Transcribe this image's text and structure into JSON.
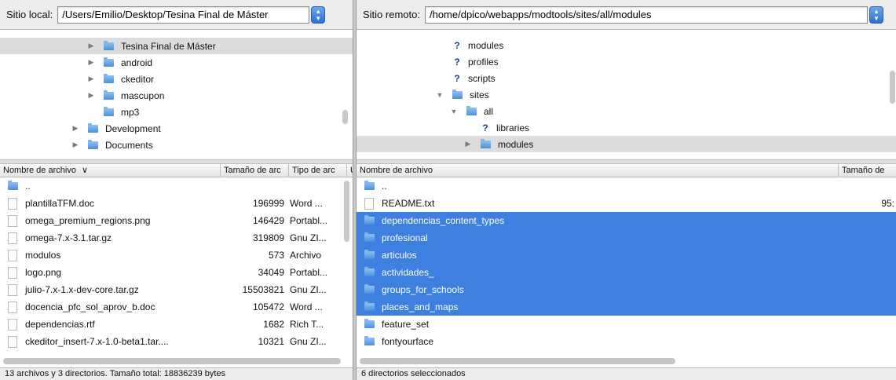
{
  "local": {
    "label": "Sitio local:",
    "path": "/Users/Emilio/Desktop/Tesina Final de Máster",
    "tree": [
      {
        "name": "Tesina Final de Máster",
        "indent": 2,
        "kind": "folder",
        "expander": true,
        "selected": true
      },
      {
        "name": "android",
        "indent": 2,
        "kind": "folder",
        "expander": true
      },
      {
        "name": "ckeditor",
        "indent": 2,
        "kind": "folder",
        "expander": true
      },
      {
        "name": "mascupon",
        "indent": 2,
        "kind": "folder",
        "expander": true
      },
      {
        "name": "mp3",
        "indent": 2,
        "kind": "folder",
        "expander": false
      },
      {
        "name": "Development",
        "indent": 1,
        "kind": "folder",
        "expander": true
      },
      {
        "name": "Documents",
        "indent": 1,
        "kind": "folder",
        "expander": true
      }
    ],
    "columns": {
      "name": "Nombre de archivo",
      "size": "Tamaño de arc",
      "type": "Tipo de arc",
      "last": "Ú"
    },
    "sort_indicator": "∨",
    "files": [
      {
        "name": "..",
        "size": "",
        "type": "",
        "icon": "folder"
      },
      {
        "name": "plantillaTFM.doc",
        "size": "196999",
        "type": "Word ...",
        "icon": "doc"
      },
      {
        "name": "omega_premium_regions.png",
        "size": "146429",
        "type": "Portabl...",
        "icon": "doc"
      },
      {
        "name": "omega-7.x-3.1.tar.gz",
        "size": "319809",
        "type": "Gnu ZI...",
        "icon": "doc"
      },
      {
        "name": "modulos",
        "size": "573",
        "type": "Archivo",
        "icon": "doc"
      },
      {
        "name": "logo.png",
        "size": "34049",
        "type": "Portabl...",
        "icon": "doc"
      },
      {
        "name": "julio-7.x-1.x-dev-core.tar.gz",
        "size": "15503821",
        "type": "Gnu ZI...",
        "icon": "doc"
      },
      {
        "name": "docencia_pfc_sol_aprov_b.doc",
        "size": "105472",
        "type": "Word ...",
        "icon": "doc"
      },
      {
        "name": "dependencias.rtf",
        "size": "1682",
        "type": "Rich T...",
        "icon": "doc"
      },
      {
        "name": "ckeditor_insert-7.x-1.0-beta1.tar....",
        "size": "10321",
        "type": "Gnu ZI...",
        "icon": "doc"
      }
    ],
    "status": "13 archivos y 3 directorios. Tamaño total: 18836239 bytes"
  },
  "remote": {
    "label": "Sitio remoto:",
    "path": "/home/dpico/webapps/modtools/sites/all/modules",
    "tree": [
      {
        "name": "modules",
        "indent": 0,
        "kind": "unknown",
        "expander": false
      },
      {
        "name": "profiles",
        "indent": 0,
        "kind": "unknown",
        "expander": false
      },
      {
        "name": "scripts",
        "indent": 0,
        "kind": "unknown",
        "expander": false
      },
      {
        "name": "sites",
        "indent": 0,
        "kind": "folder",
        "expander": "open"
      },
      {
        "name": "all",
        "indent": 1,
        "kind": "folder",
        "expander": "open"
      },
      {
        "name": "libraries",
        "indent": 2,
        "kind": "unknown",
        "expander": false
      },
      {
        "name": "modules",
        "indent": 2,
        "kind": "folder",
        "expander": true,
        "selected": true
      }
    ],
    "columns": {
      "name": "Nombre de archivo",
      "size": "Tamaño de"
    },
    "files": [
      {
        "name": "..",
        "size": "",
        "icon": "folder",
        "selected": false
      },
      {
        "name": "README.txt",
        "size": "95:",
        "icon": "doc",
        "selected": false
      },
      {
        "name": "dependencias_content_types",
        "size": "",
        "icon": "folder",
        "selected": true
      },
      {
        "name": "profesional",
        "size": "",
        "icon": "folder",
        "selected": true
      },
      {
        "name": "articulos",
        "size": "",
        "icon": "folder",
        "selected": true
      },
      {
        "name": "actividades_",
        "size": "",
        "icon": "folder",
        "selected": true
      },
      {
        "name": "groups_for_schools",
        "size": "",
        "icon": "folder",
        "selected": true
      },
      {
        "name": "places_and_maps",
        "size": "",
        "icon": "folder",
        "selected": true
      },
      {
        "name": "feature_set",
        "size": "",
        "icon": "folder",
        "selected": false
      },
      {
        "name": "fontyourface",
        "size": "",
        "icon": "folder",
        "selected": false
      }
    ],
    "status": "6 directorios seleccionados"
  },
  "accent_color": "#3d80df"
}
